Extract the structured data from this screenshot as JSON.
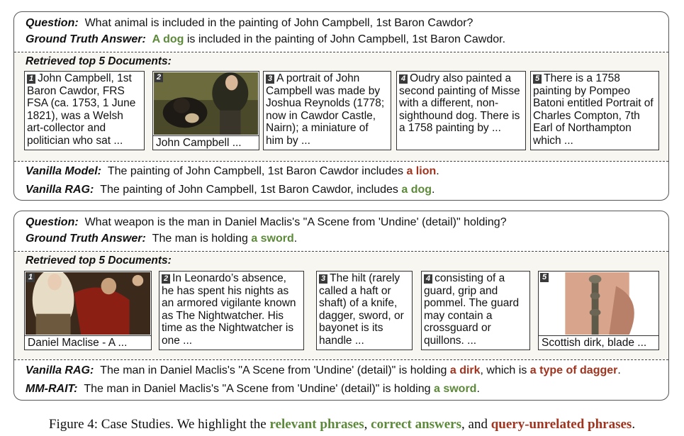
{
  "case1": {
    "question_label": "Question:",
    "question": "What animal is included in the painting of John Campbell, 1st Baron Cawdor?",
    "gt_label": "Ground Truth Answer:",
    "gt_highlight": "A dog",
    "gt_rest": " is included in the painting of John Campbell, 1st Baron Cawdor.",
    "retrieved_label": "Retrieved top 5 Documents:",
    "docs": [
      {
        "num": "1",
        "text": "John Campbell, 1st Baron Cawdor, FRS FSA (ca. 1753, 1 June 1821), was a Welsh art-collector and politician who sat ..."
      },
      {
        "num": "2",
        "caption": "John Campbell ..."
      },
      {
        "num": "3",
        "text": "A portrait of John Campbell was made by Joshua Reynolds (1778; now in Cawdor Castle, Nairn); a miniature of him by ..."
      },
      {
        "num": "4",
        "text": "Oudry also painted a second painting of Misse with a different, non-sighthound dog. There is a 1758 painting by ..."
      },
      {
        "num": "5",
        "text": "There is a 1758 painting by Pompeo Batoni entitled Portrait of Charles Compton, 7th Earl of Northampton which ..."
      }
    ],
    "ans1_label": "Vanilla Model:",
    "ans1_pre": "The painting of John Campbell, 1st Baron Cawdor includes ",
    "ans1_hl": "a lion",
    "ans1_post": ".",
    "ans2_label": "Vanilla RAG:",
    "ans2_pre": "The painting of John Campbell, 1st Baron Cawdor, includes ",
    "ans2_hl": "a dog",
    "ans2_post": "."
  },
  "case2": {
    "question_label": "Question:",
    "question": "What weapon is the man in Daniel Maclis's  \"A Scene from 'Undine' (detail)\" holding?",
    "gt_label": "Ground Truth Answer:",
    "gt_pre": "The man is holding ",
    "gt_highlight": "a sword",
    "gt_post": ".",
    "retrieved_label": "Retrieved top 5 Documents:",
    "docs": [
      {
        "num": "1",
        "caption": "Daniel Maclise - A ..."
      },
      {
        "num": "2",
        "text": "In Leonardo’s absence, he has spent his nights as an armored vigilante known as The Nightwatcher. His time as the Nightwatcher is one ..."
      },
      {
        "num": "3",
        "text": "The hilt (rarely called a haft or shaft) of a knife, dagger, sword, or bayonet is its handle ..."
      },
      {
        "num": "4",
        "text": "consisting of a guard, grip and pommel. The guard may contain a crossguard or quillons. ..."
      },
      {
        "num": "5",
        "caption": "Scottish dirk, blade ..."
      }
    ],
    "ans1_label": "Vanilla RAG:",
    "ans1_pre": "The man in Daniel Maclis's \"A Scene from 'Undine' (detail)\" is holding ",
    "ans1_hl": "a dirk",
    "ans1_mid": ", which is ",
    "ans1_hl2": "a type of dagger",
    "ans1_post": ".",
    "ans2_label": "MM-RAIT:",
    "ans2_pre": "The man in Daniel Maclis's \"A Scene from 'Undine' (detail)\" is holding ",
    "ans2_hl": "a sword",
    "ans2_post": "."
  },
  "caption": {
    "prefix": "Figure 4: Case Studies. We highlight the ",
    "relevant": "relevant phrases",
    "sep1": ", ",
    "correct": "correct answers",
    "sep2": ", and ",
    "unrelated": "query-unrelated phrases",
    "suffix": "."
  },
  "colors": {
    "relevant": "#5d8a3a",
    "unrelated": "#a0341f"
  }
}
